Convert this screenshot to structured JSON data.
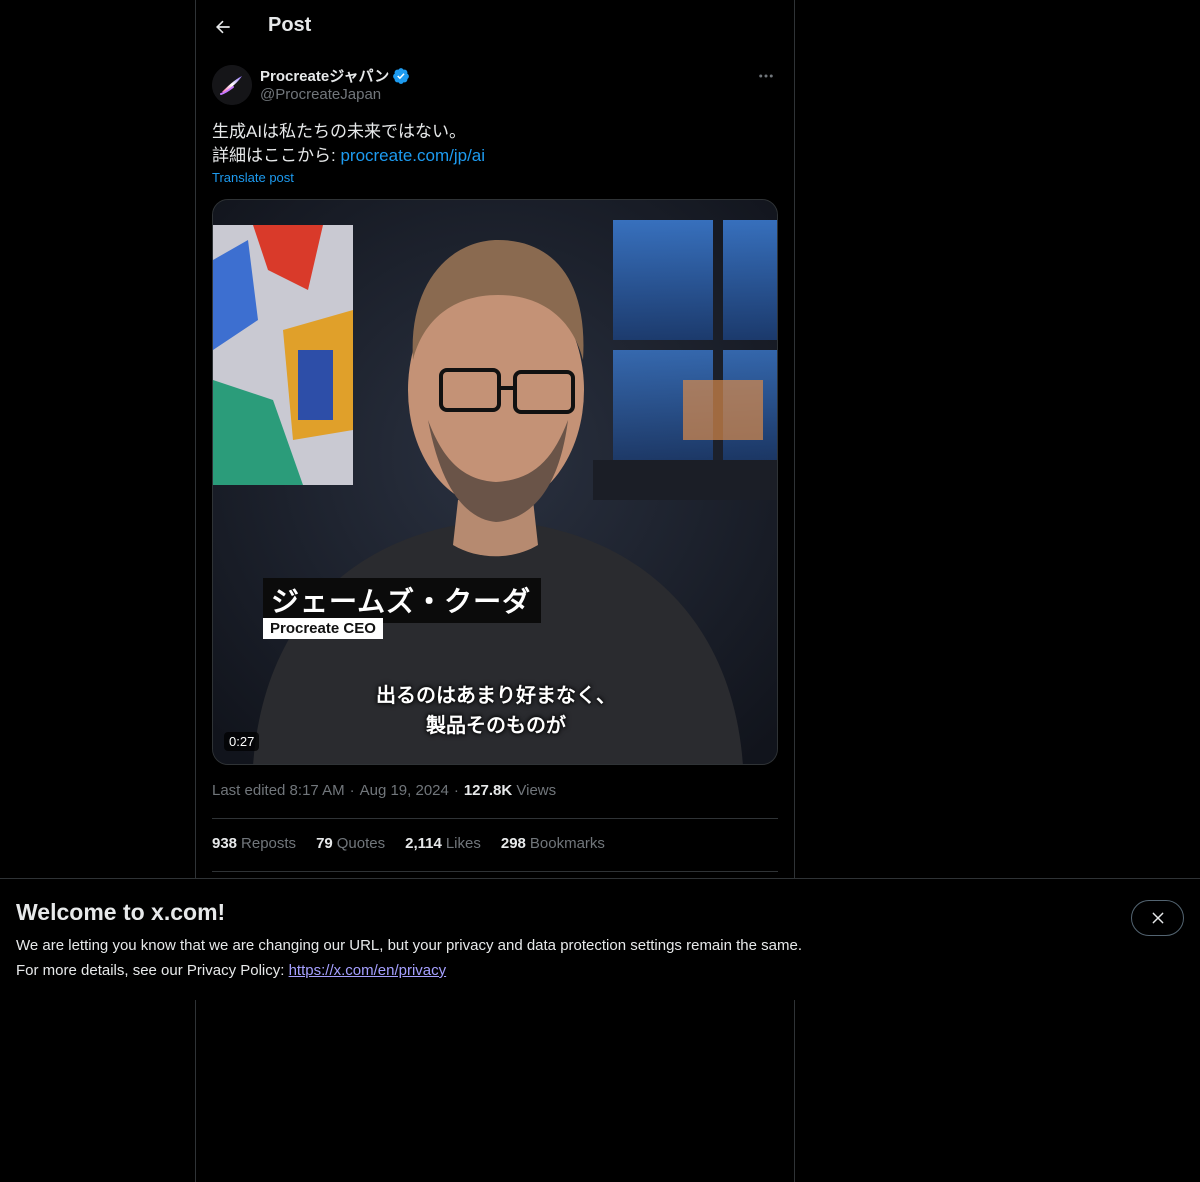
{
  "header": {
    "title": "Post"
  },
  "post": {
    "display_name": "Procreateジャパン",
    "handle": "@ProcreateJapan",
    "text_line1": "生成AIは私たちの未来ではない。",
    "text_line2_prefix": "詳細はここから: ",
    "link_text": "procreate.com/jp/ai",
    "translate_label": "Translate post",
    "video": {
      "caption_name": "ジェームズ・クーダ",
      "caption_title": "Procreate CEO",
      "subtitle_line1": "出るのはあまり好まなく、",
      "subtitle_line2": "製品そのものが",
      "duration": "0:27"
    },
    "meta": {
      "edited_time": "Last edited 8:17 AM",
      "date": "Aug 19, 2024",
      "views_count": "127.8K",
      "views_label": "Views"
    },
    "stats": [
      {
        "count": "938",
        "label": "Reposts"
      },
      {
        "count": "79",
        "label": "Quotes"
      },
      {
        "count": "2,114",
        "label": "Likes"
      },
      {
        "count": "298",
        "label": "Bookmarks"
      }
    ]
  },
  "banner": {
    "title": "Welcome to x.com!",
    "line1": "We are letting you know that we are changing our URL, but your privacy and data protection settings remain the same.",
    "line2_prefix": "For more details, see our Privacy Policy: ",
    "link_text": "https://x.com/en/privacy"
  },
  "colors": {
    "accent": "#1d9bf0",
    "background": "#000000",
    "border": "#2f3336",
    "muted": "#71767b"
  },
  "icons": {
    "back": "arrow-left-icon",
    "verified": "verified-badge-icon",
    "more": "more-dots-icon",
    "close": "close-icon"
  }
}
